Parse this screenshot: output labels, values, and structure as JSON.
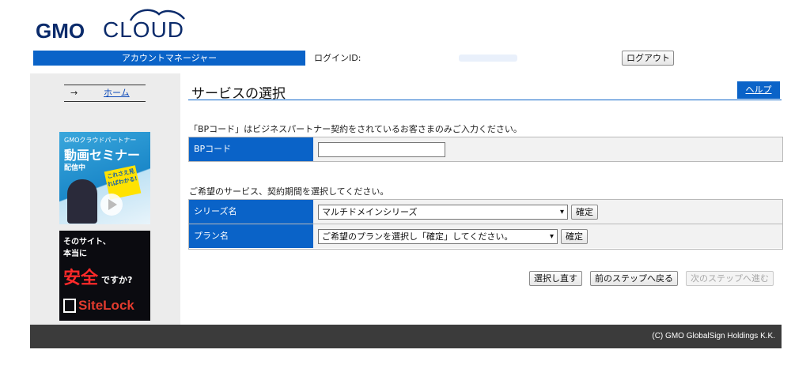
{
  "logo": {
    "gmo": "GMO",
    "cloud": "CLOUD"
  },
  "header": {
    "bar_title": "アカウントマネージャー",
    "login_label": "ログインID:",
    "logout_label": "ログアウト"
  },
  "sidebar": {
    "home_arrow": "→",
    "home_label": "ホーム",
    "banner_seminar": {
      "line1": "GMOクラウドパートナー",
      "line2": "動画セミナー",
      "line3": "配信中",
      "badge": "これさえ見ればわかる!"
    },
    "banner_sitelock": {
      "line1": "そのサイト、",
      "line2": "本当に",
      "line3": "安全",
      "line4": "ですか?",
      "brand": "SiteLock"
    }
  },
  "main": {
    "title": "サービスの選択",
    "help_label": "ヘルプ",
    "bp_note": "「BPコード」はビジネスパートナー契約をされているお客さまのみご入力ください。",
    "bp_label": "BPコード",
    "bp_value": "",
    "service_note": "ご希望のサービス、契約期間を選択してください。",
    "series_label": "シリーズ名",
    "series_value": "マルチドメインシリーズ",
    "plan_label": "プラン名",
    "plan_value": "ご希望のプランを選択し「確定」してください。",
    "confirm_label": "確定",
    "reset_label": "選択し直す",
    "back_label": "前のステップへ戻る",
    "next_label": "次のステップへ進む"
  },
  "footer": {
    "copyright": "(C) GMO GlobalSign Holdings K.K."
  },
  "colors": {
    "accent": "#0a63c8",
    "footer_bg": "#3b3b3b",
    "sidebar_bg": "#ececec"
  }
}
